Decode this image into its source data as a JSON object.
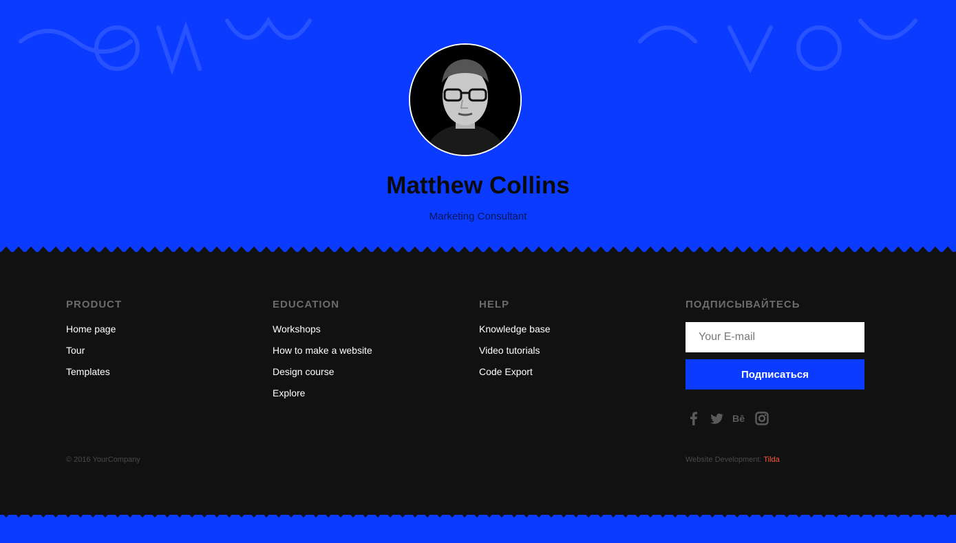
{
  "profile": {
    "name": "Matthew Collins",
    "role": "Marketing Consultant"
  },
  "footer": {
    "columns": [
      {
        "title": "PRODUCT",
        "links": [
          "Home page",
          "Tour",
          "Templates"
        ]
      },
      {
        "title": "EDUCATION",
        "links": [
          "Workshops",
          "How to make a website",
          "Design course",
          "Explore"
        ]
      },
      {
        "title": "HELP",
        "links": [
          "Knowledge base",
          "Video tutorials",
          "Code Export"
        ]
      }
    ],
    "subscribe": {
      "title": "ПОДПИСЫВАЙТЕСЬ",
      "email_placeholder": "Your E-mail",
      "button_label": "Подписаться"
    },
    "socials": [
      "facebook-icon",
      "twitter-icon",
      "behance-icon",
      "instagram-icon"
    ],
    "copyright": "© 2016 YourCompany",
    "dev_prefix": "Website Development: ",
    "dev_link": "Tilda"
  },
  "colors": {
    "accent_blue": "#0a3bff",
    "footer_bg": "#111111",
    "link_highlight": "#ff5a3c"
  }
}
